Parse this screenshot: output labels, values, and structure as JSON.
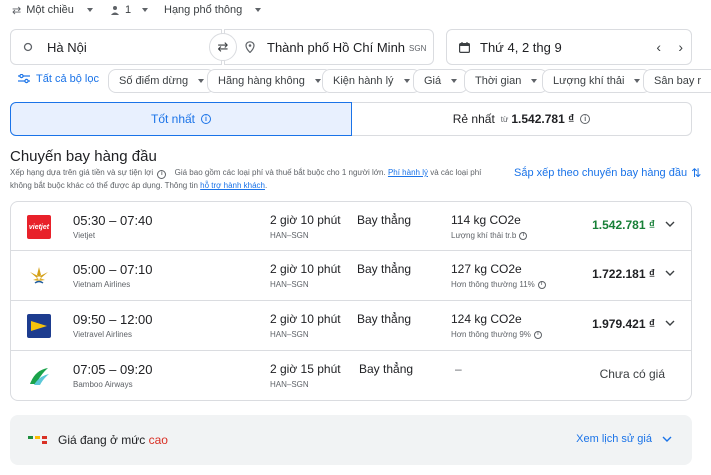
{
  "top_options": {
    "trip_type": "Một chiều",
    "passengers": "1",
    "cabin_class": "Hạng phổ thông"
  },
  "search": {
    "origin": "Hà Nội",
    "destination": "Thành phố Hồ Chí Minh",
    "destination_code": "SGN",
    "date": "Thứ 4, 2 thg 9"
  },
  "filters": {
    "all_filters": "Tất cả bộ lọc",
    "chips": [
      "Số điểm dừng",
      "Hãng hàng không",
      "Kiện hành lý",
      "Giá",
      "Thời gian",
      "Lượng khí thải",
      "Sân bay r"
    ]
  },
  "sort_tabs": {
    "best_label": "Tốt nhất",
    "cheapest_label": "Rẻ nhất",
    "cheapest_prefix": "từ",
    "cheapest_price": "1.542.781 ₫"
  },
  "results": {
    "heading": "Chuyến bay hàng đầu",
    "note_part1": "Xếp hạng dựa trên giá tiền và sự tiện lợi",
    "note_part2": "Giá bao gồm các loại phí và thuế bắt buộc cho 1 người lớn.",
    "note_link1": "Phí hành lý",
    "note_part3": "và các loại phí",
    "note_line2": "không bắt buộc khác có thể được áp dụng. Thông tin",
    "note_link2": "hỗ trợ hành khách",
    "note_end": ".",
    "sort_link": "Sắp xếp theo chuyến bay hàng đầu"
  },
  "flights": [
    {
      "times": "05:30 – 07:40",
      "airline": "Vietjet",
      "duration": "2 giờ 10 phút",
      "route": "HAN–SGN",
      "stops": "Bay thẳng",
      "co2": "114 kg CO2e",
      "co2_note": "Lượng khí thải tr.b",
      "price": "1.542.781 ₫",
      "price_color": "#188038"
    },
    {
      "times": "05:00 – 07:10",
      "airline": "Vietnam Airlines",
      "duration": "2 giờ 10 phút",
      "route": "HAN–SGN",
      "stops": "Bay thẳng",
      "co2": "127 kg CO2e",
      "co2_note": "Hơn thông thường 11%",
      "price": "1.722.181 ₫",
      "price_color": "#202124"
    },
    {
      "times": "09:50 – 12:00",
      "airline": "Vietravel Airlines",
      "duration": "2 giờ 10 phút",
      "route": "HAN–SGN",
      "stops": "Bay thẳng",
      "co2": "124 kg CO2e",
      "co2_note": "Hơn thông thường 9%",
      "price": "1.979.421 ₫",
      "price_color": "#202124"
    },
    {
      "times": "07:05 – 09:20",
      "airline": "Bamboo Airways",
      "duration": "2 giờ 15 phút",
      "route": "HAN–SGN",
      "stops": "Bay thẳng",
      "co2": "–",
      "co2_note": "",
      "price": "Chưa có giá",
      "price_color": "#3c4043"
    }
  ],
  "price_insight": {
    "prefix": "Giá đang ở mức",
    "level": "cao",
    "level_color": "#d93025",
    "history_link": "Xem lịch sử giá"
  },
  "colors": {
    "accent": "#1a73e8",
    "selected_tab_bg": "#e8f0fe",
    "vietjet": "#e8212a",
    "vietnam_airlines": "#d4a017",
    "vietravel": "#1d3c8f",
    "bamboo": "#1aa34a"
  }
}
